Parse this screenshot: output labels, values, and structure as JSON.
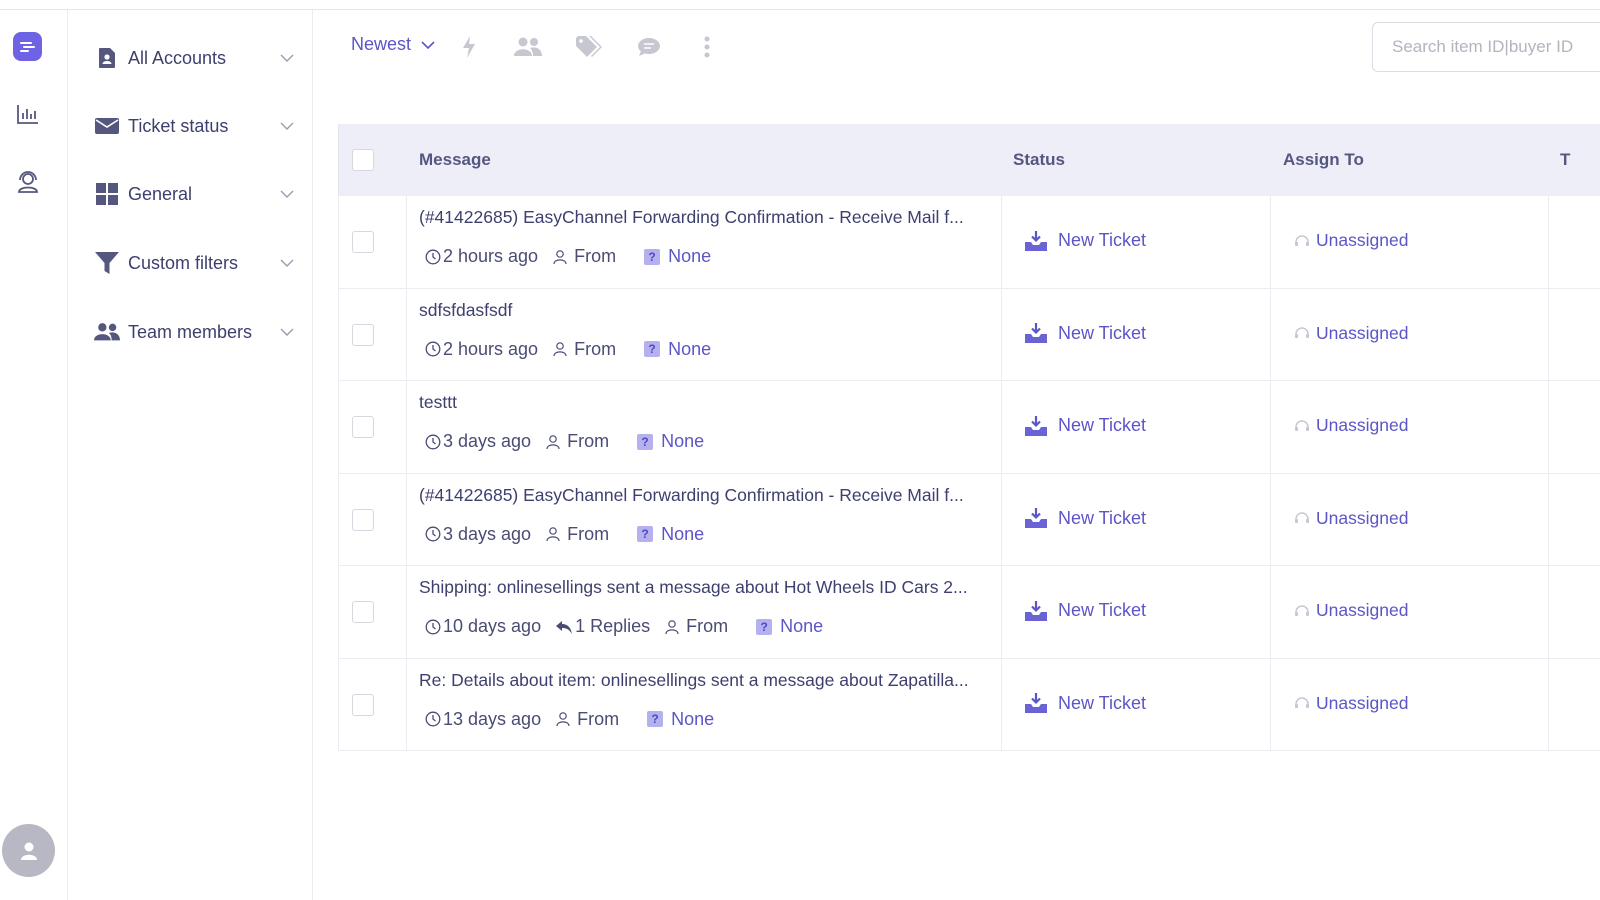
{
  "rail": {
    "icons": [
      "menu-icon",
      "chart-icon",
      "support-icon",
      "user-icon"
    ]
  },
  "sidebar": {
    "items": [
      {
        "label": "All Accounts",
        "icon": "document-user-icon"
      },
      {
        "label": "Ticket status",
        "icon": "envelope-icon"
      },
      {
        "label": "General",
        "icon": "grid-icon"
      },
      {
        "label": "Custom filters",
        "icon": "filter-icon"
      },
      {
        "label": "Team members",
        "icon": "users-icon"
      }
    ]
  },
  "toolbar": {
    "sort_label": "Newest",
    "icons": [
      "bolt-icon",
      "users-icon",
      "tag-icon",
      "comment-icon",
      "more-vertical-icon"
    ],
    "search_placeholder": "Search item ID|buyer ID"
  },
  "table": {
    "headers": {
      "message": "Message",
      "status": "Status",
      "assign_to": "Assign To",
      "next": "T"
    },
    "rows": [
      {
        "title": "(#41422685) EasyChannel Forwarding Confirmation - Receive Mail f...",
        "time": "2 hours ago",
        "replies": "",
        "from": "From",
        "tag": "None",
        "status": "New Ticket",
        "assignee": "Unassigned"
      },
      {
        "title": "sdfsfdasfsdf",
        "time": "2 hours ago",
        "replies": "",
        "from": "From",
        "tag": "None",
        "status": "New Ticket",
        "assignee": "Unassigned"
      },
      {
        "title": "testtt",
        "time": "3 days ago",
        "replies": "",
        "from": "From",
        "tag": "None",
        "status": "New Ticket",
        "assignee": "Unassigned"
      },
      {
        "title": "(#41422685) EasyChannel Forwarding Confirmation - Receive Mail f...",
        "time": "3 days ago",
        "replies": "",
        "from": "From",
        "tag": "None",
        "status": "New Ticket",
        "assignee": "Unassigned"
      },
      {
        "title": "Shipping: onlinesellings sent a message about Hot Wheels ID Cars 2...",
        "time": "10 days ago",
        "replies": "1 Replies",
        "from": "From",
        "tag": "None",
        "status": "New Ticket",
        "assignee": "Unassigned"
      },
      {
        "title": "Re: Details about item: onlinesellings sent a message about Zapatilla...",
        "time": "13 days ago",
        "replies": "",
        "from": "From",
        "tag": "None",
        "status": "New Ticket",
        "assignee": "Unassigned"
      }
    ]
  },
  "colors": {
    "accent": "#6e62e5",
    "link": "#5c55c8",
    "header_bg": "#eeeef9",
    "text": "#3d3f6e"
  }
}
